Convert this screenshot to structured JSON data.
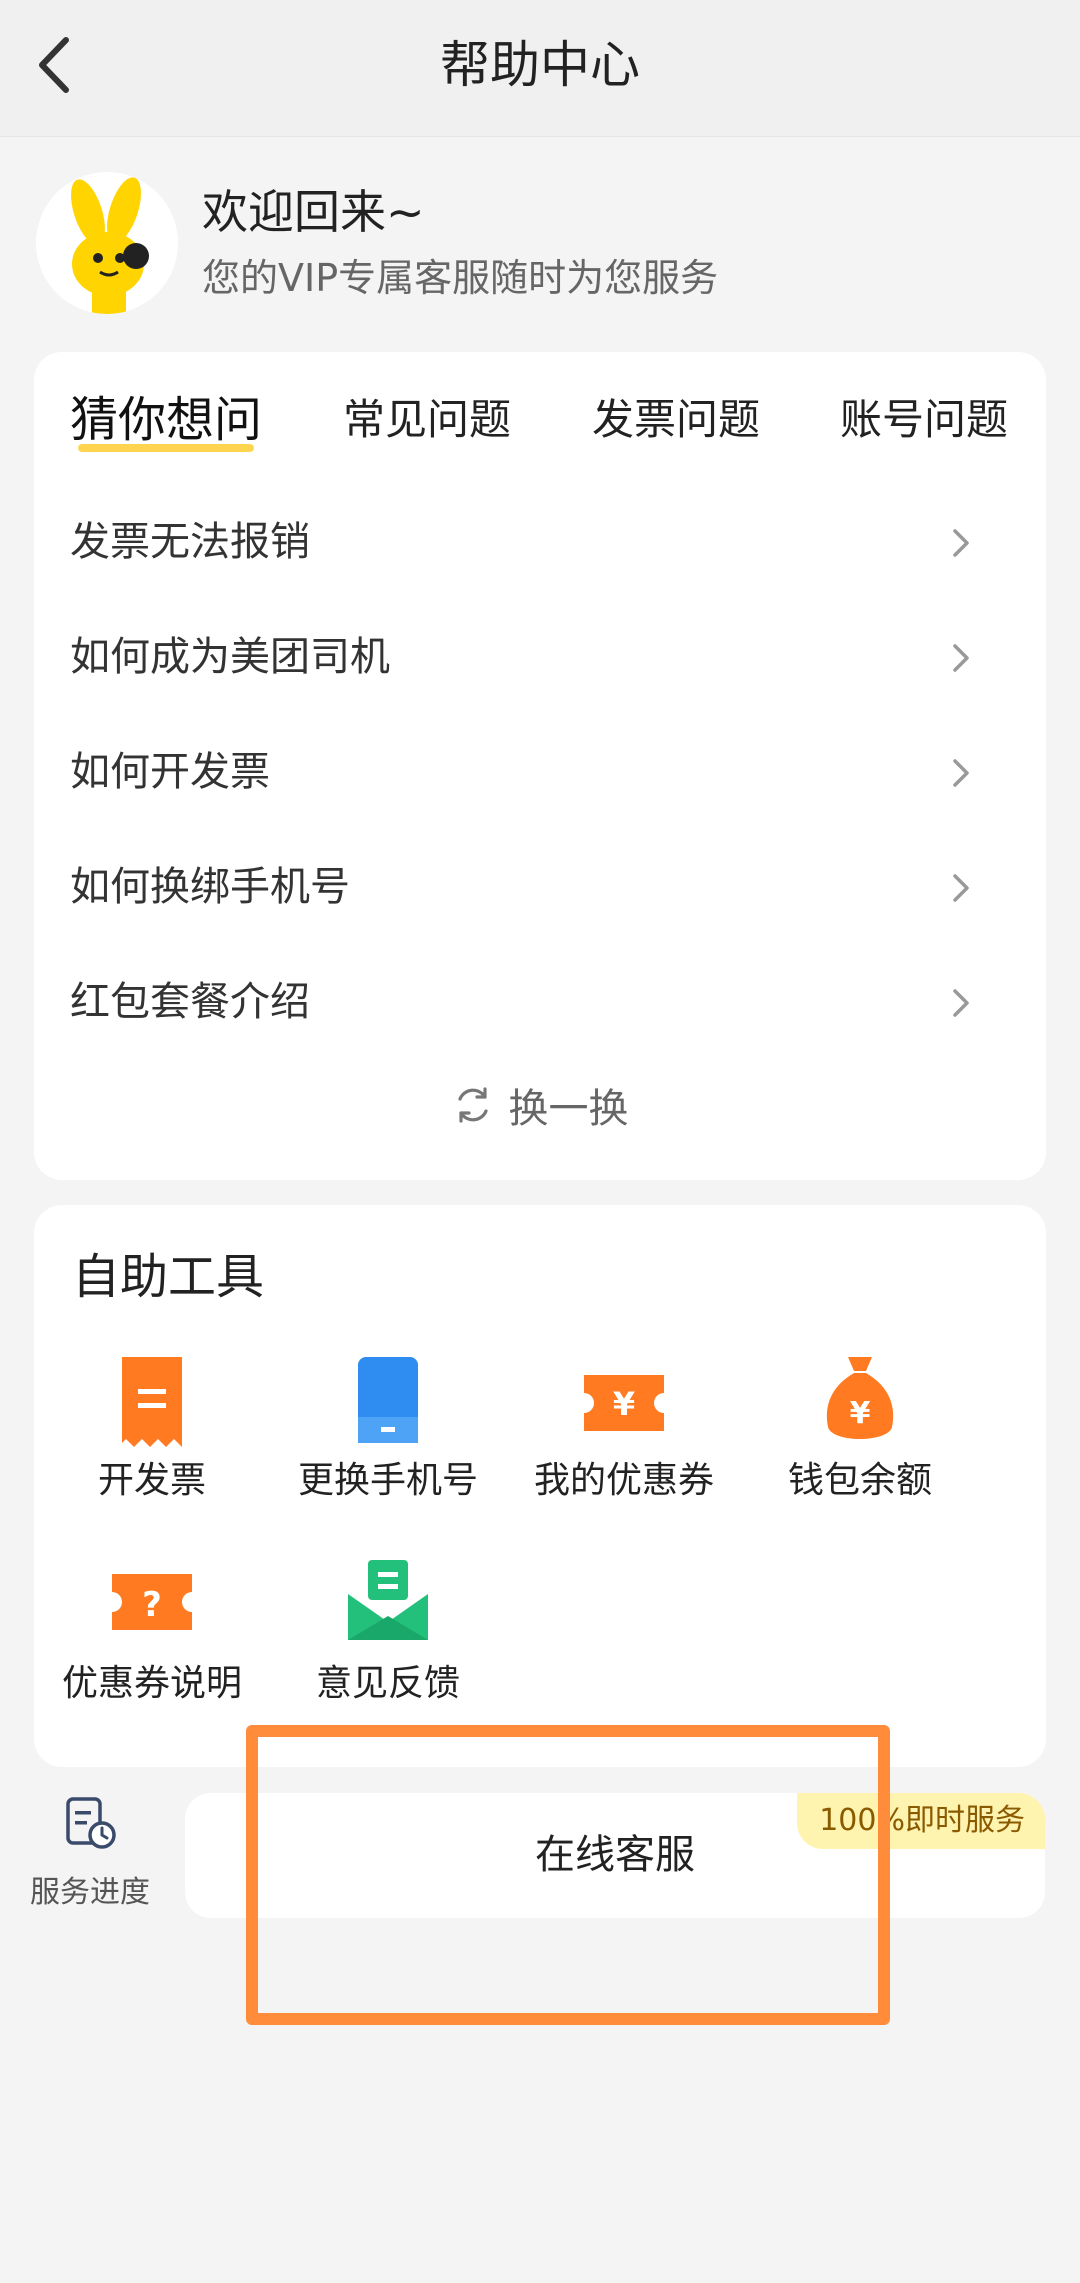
{
  "header": {
    "title": "帮助中心"
  },
  "welcome": {
    "title": "欢迎回来~",
    "subtitle": "您的VIP专属客服随时为您服务"
  },
  "faq": {
    "tabs": [
      "猜你想问",
      "常见问题",
      "发票问题",
      "账号问题"
    ],
    "active_tab": 0,
    "items": [
      "发票无法报销",
      "如何成为美团司机",
      "如何开发票",
      "如何换绑手机号",
      "红包套餐介绍"
    ],
    "refresh_label": "换一换"
  },
  "tools": {
    "title": "自助工具",
    "items": [
      {
        "label": "开发票",
        "icon": "invoice-icon"
      },
      {
        "label": "更换手机号",
        "icon": "phone-icon"
      },
      {
        "label": "我的优惠券",
        "icon": "coupon-icon"
      },
      {
        "label": "钱包余额",
        "icon": "wallet-bag-icon"
      },
      {
        "label": "优惠券说明",
        "icon": "coupon-help-icon"
      },
      {
        "label": "意见反馈",
        "icon": "feedback-envelope-icon"
      }
    ]
  },
  "service": {
    "progress_label": "服务进度",
    "online_label": "在线客服",
    "online_badge": "100%即时服务"
  },
  "colors": {
    "accent_yellow": "#ffd54f",
    "orange": "#ff7a21",
    "blue": "#2f8cf0",
    "green": "#22c07a",
    "highlight": "#ff8c3a"
  }
}
